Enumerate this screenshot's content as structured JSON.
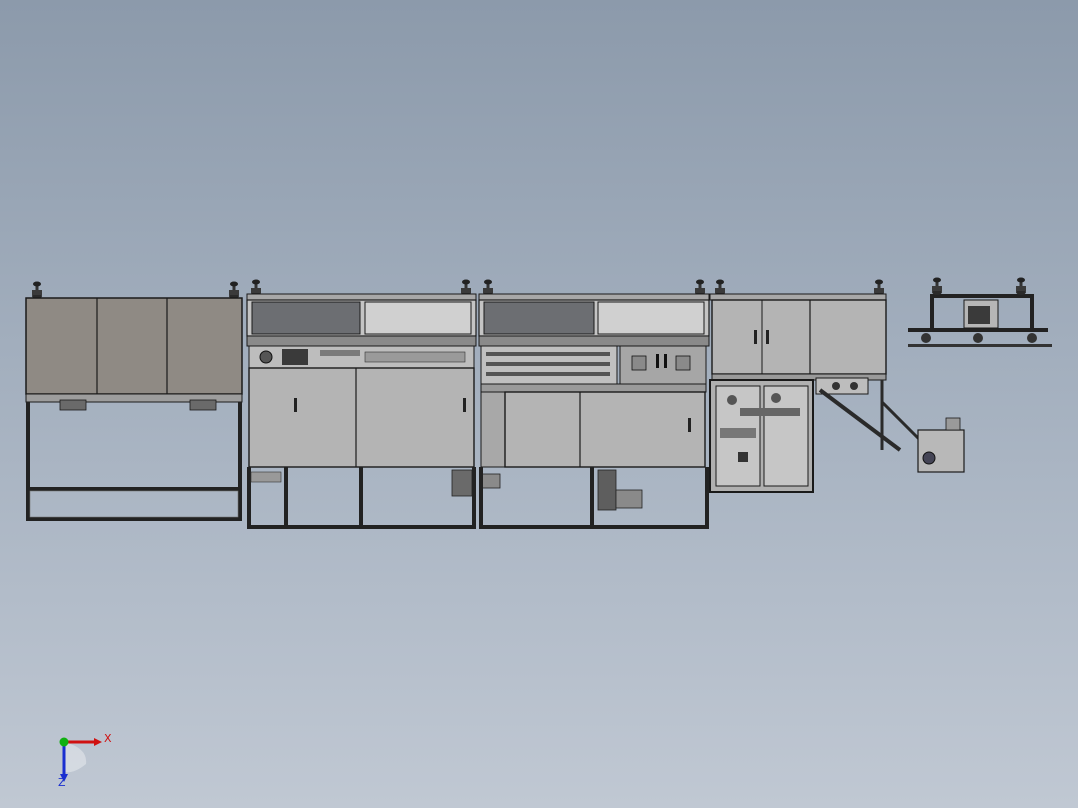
{
  "viewport": {
    "background_top": "#8c9aab",
    "background_bottom": "#c0c8d3"
  },
  "model": {
    "description_visible": false,
    "colors": {
      "panel_fill": "#8f8a84",
      "door_fill": "#b4b4b4",
      "frame_stroke": "#1a1a1a",
      "window_fill": "#6c6e72",
      "window_fill_light": "#c8c8c8"
    }
  },
  "triad": {
    "x_label": "X",
    "z_label": "Z",
    "x_color": "#d01010",
    "y_color": "#10b010",
    "z_color": "#1a2fd0"
  }
}
